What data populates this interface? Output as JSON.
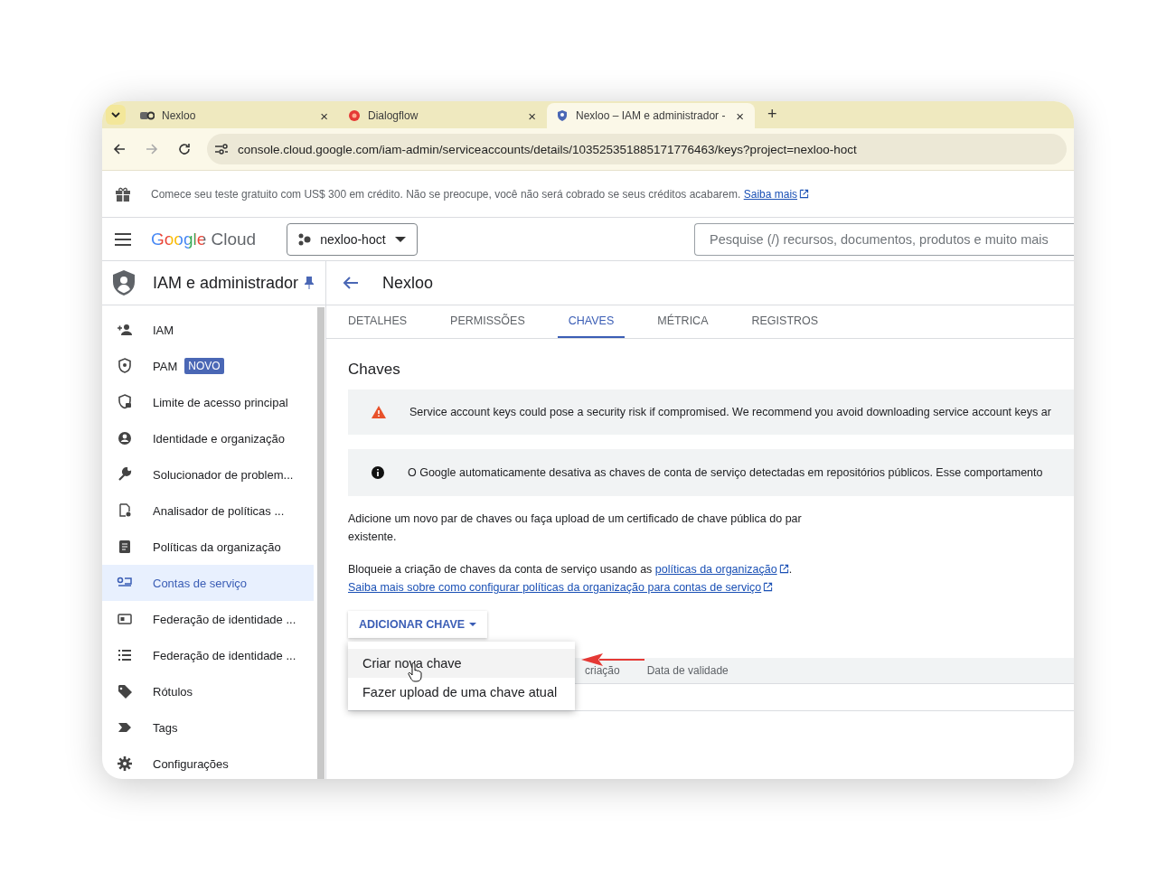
{
  "browser": {
    "tabs": [
      {
        "title": "Nexloo",
        "selected": false,
        "close": "×"
      },
      {
        "title": "Dialogflow",
        "selected": false,
        "close": "×"
      },
      {
        "title": "Nexloo – IAM e administrador -",
        "selected": true,
        "close": "×"
      }
    ],
    "new_tab": "+",
    "url": "console.cloud.google.com/iam-admin/serviceaccounts/details/103525351885171776463/keys?project=nexloo-hoct"
  },
  "banner": {
    "text": "Comece seu teste gratuito com US$ 300 em crédito. Não se preocupe, você não será cobrado se seus créditos acabarem.",
    "link": "Saiba mais"
  },
  "header": {
    "logo": "Google Cloud",
    "project": "nexloo-hoct",
    "search_placeholder": "Pesquise (/) recursos, documentos, produtos e muito mais"
  },
  "sidebar": {
    "title": "IAM e administrador",
    "items": [
      {
        "label": "IAM",
        "selected": false
      },
      {
        "label": "PAM",
        "badge": "NOVO",
        "selected": false
      },
      {
        "label": "Limite de acesso principal",
        "selected": false
      },
      {
        "label": "Identidade e organização",
        "selected": false
      },
      {
        "label": "Solucionador de problem...",
        "selected": false
      },
      {
        "label": "Analisador de políticas ...",
        "selected": false
      },
      {
        "label": "Políticas da organização",
        "selected": false
      },
      {
        "label": "Contas de serviço",
        "selected": true
      },
      {
        "label": "Federação de identidade ...",
        "selected": false
      },
      {
        "label": "Federação de identidade ...",
        "selected": false
      },
      {
        "label": "Rótulos",
        "selected": false
      },
      {
        "label": "Tags",
        "selected": false
      },
      {
        "label": "Configurações",
        "selected": false
      }
    ]
  },
  "page": {
    "title": "Nexloo",
    "tabs": [
      {
        "label": "DETALHES",
        "selected": false
      },
      {
        "label": "PERMISSÕES",
        "selected": false
      },
      {
        "label": "CHAVES",
        "selected": true
      },
      {
        "label": "MÉTRICA",
        "selected": false
      },
      {
        "label": "REGISTROS",
        "selected": false
      }
    ],
    "section_title": "Chaves",
    "alerts": [
      {
        "kind": "warning",
        "text": "Service account keys could pose a security risk if compromised. We recommend you avoid downloading service account keys ar"
      },
      {
        "kind": "info",
        "text": "O Google automaticamente desativa as chaves de conta de serviço detectadas em repositórios públicos. Esse comportamento"
      }
    ],
    "description": "Adicione um novo par de chaves ou faça upload de um certificado de chave pública do par existente.",
    "policy_text": "Bloqueie a criação de chaves da conta de serviço usando as",
    "policy_link": "políticas da organização",
    "policy_end": ".",
    "learn_link": "Saiba mais sobre como configurar políticas da organização para contas de serviço",
    "add_key_button": "ADICIONAR CHAVE",
    "menu": [
      {
        "label": "Criar nova chave",
        "hovered": true
      },
      {
        "label": "Fazer upload de uma chave atual",
        "hovered": false
      }
    ],
    "table_columns": [
      "criação",
      "Data de validade"
    ]
  }
}
